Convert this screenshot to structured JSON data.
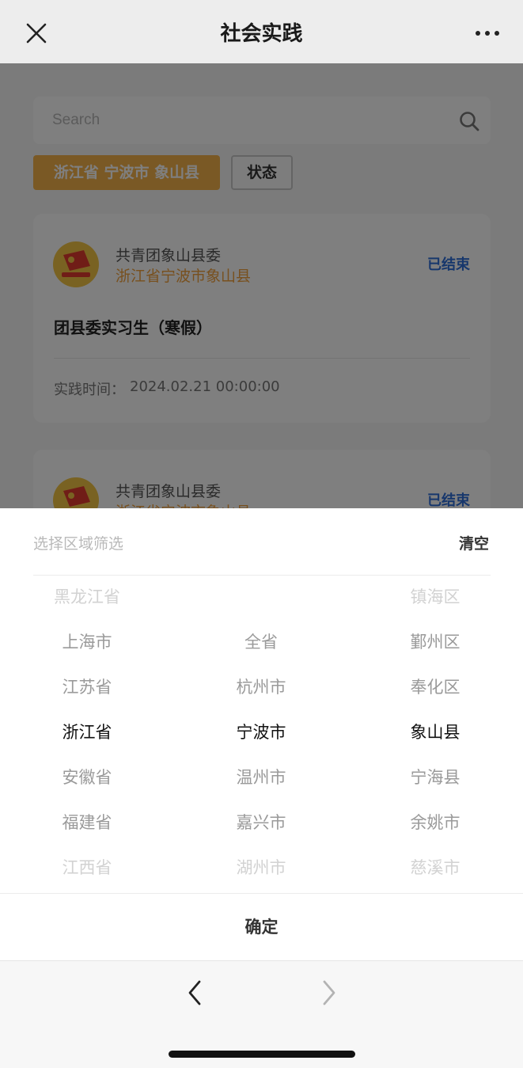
{
  "nav": {
    "title": "社会实践",
    "close_icon": "close-icon",
    "more_icon": "more-icon"
  },
  "search": {
    "placeholder": "Search",
    "icon": "search-icon"
  },
  "filters": {
    "region": "浙江省 宁波市 象山县",
    "status": "状态"
  },
  "cards": [
    {
      "org": "共青团象山县委",
      "location": "浙江省宁波市象山县",
      "status": "已结束",
      "title": "团县委实习生（寒假）",
      "time_label": "实践时间：",
      "time_value": "2024.02.21 00:00:00"
    },
    {
      "org": "共青团象山县委",
      "location": "浙江省宁波市象山县",
      "status": "已结束"
    }
  ],
  "sheet": {
    "title": "选择区域筛选",
    "clear": "清空",
    "confirm": "确定",
    "provinces": [
      "黑龙江省",
      "上海市",
      "江苏省",
      "浙江省",
      "安徽省",
      "福建省",
      "江西省"
    ],
    "cities": [
      "",
      "全省",
      "杭州市",
      "宁波市",
      "温州市",
      "嘉兴市",
      "湖州市"
    ],
    "districts": [
      "镇海区",
      "鄞州区",
      "奉化区",
      "象山县",
      "宁海县",
      "余姚市",
      "慈溪市"
    ]
  },
  "colors": {
    "accent": "#f5b24a",
    "status_blue": "#2f6fd9",
    "location_orange": "#f0a03c"
  }
}
